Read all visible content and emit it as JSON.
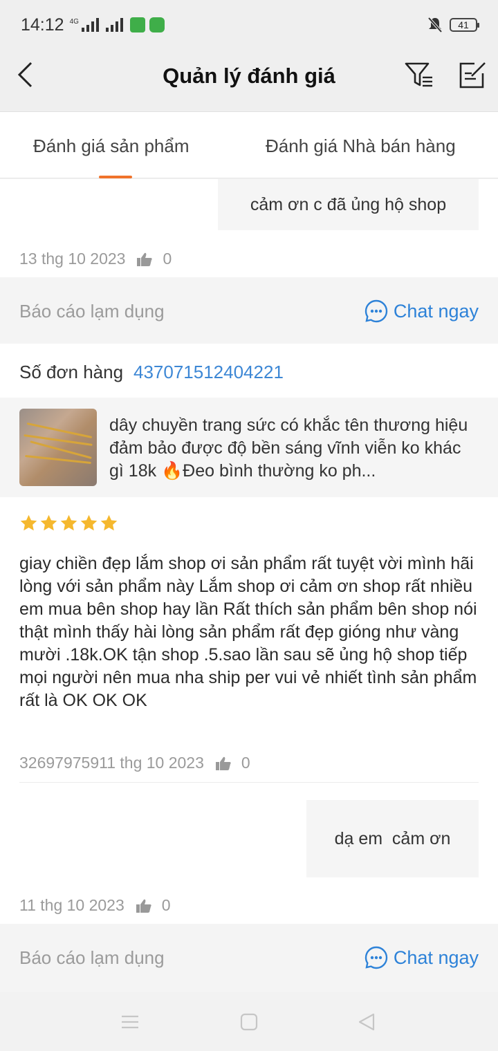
{
  "status_bar": {
    "time": "14:12",
    "network": "4G",
    "battery": "41"
  },
  "header": {
    "title": "Quản lý đánh giá"
  },
  "tabs": [
    {
      "label": "Đánh giá sản phẩm",
      "active": true
    },
    {
      "label": "Đánh giá Nhà bán hàng",
      "active": false
    }
  ],
  "review_prev": {
    "reply": "cảm ơn c đã ủng hộ shop",
    "date": "13 thg 10 2023",
    "likes": "0"
  },
  "actions": {
    "report": "Báo cáo lạm dụng",
    "chat": "Chat ngay"
  },
  "review": {
    "order_label": "Số đơn hàng",
    "order_number": "437071512404221",
    "product_desc": "dây chuyền trang sức có khắc tên thương hiệu đảm bảo được độ bền sáng vĩnh viễn ko khác gì 18k 🔥Đeo bình thường ko ph...",
    "rating": 5,
    "text": "giay chiền đẹp lắm shop ơi sản phẩm rất  tuyệt vời mình hãi lòng với sản phẩm này Lắm shop ơi cảm ơn shop rất nhiều em mua bên shop hay lần Rất thích sản phẩm bên shop nói thật mình thấy hài lòng sản phẩm rất đẹp gióng như vàng mười .18k.OK tận shop .5.sao lần sau sẽ ủng hộ shop tiếp mọi người nên mua nha ship per vui vẻ nhiết tình sản phẩm rất là OK OK OK",
    "meta": "32697975911 thg 10 2023",
    "likes": "0",
    "reply": "dạ em  cảm ơn",
    "reply_date": "11 thg 10 2023",
    "reply_likes": "0"
  },
  "colors": {
    "accent": "#f0722a",
    "link": "#2d82d8",
    "star": "#f5b82e"
  }
}
